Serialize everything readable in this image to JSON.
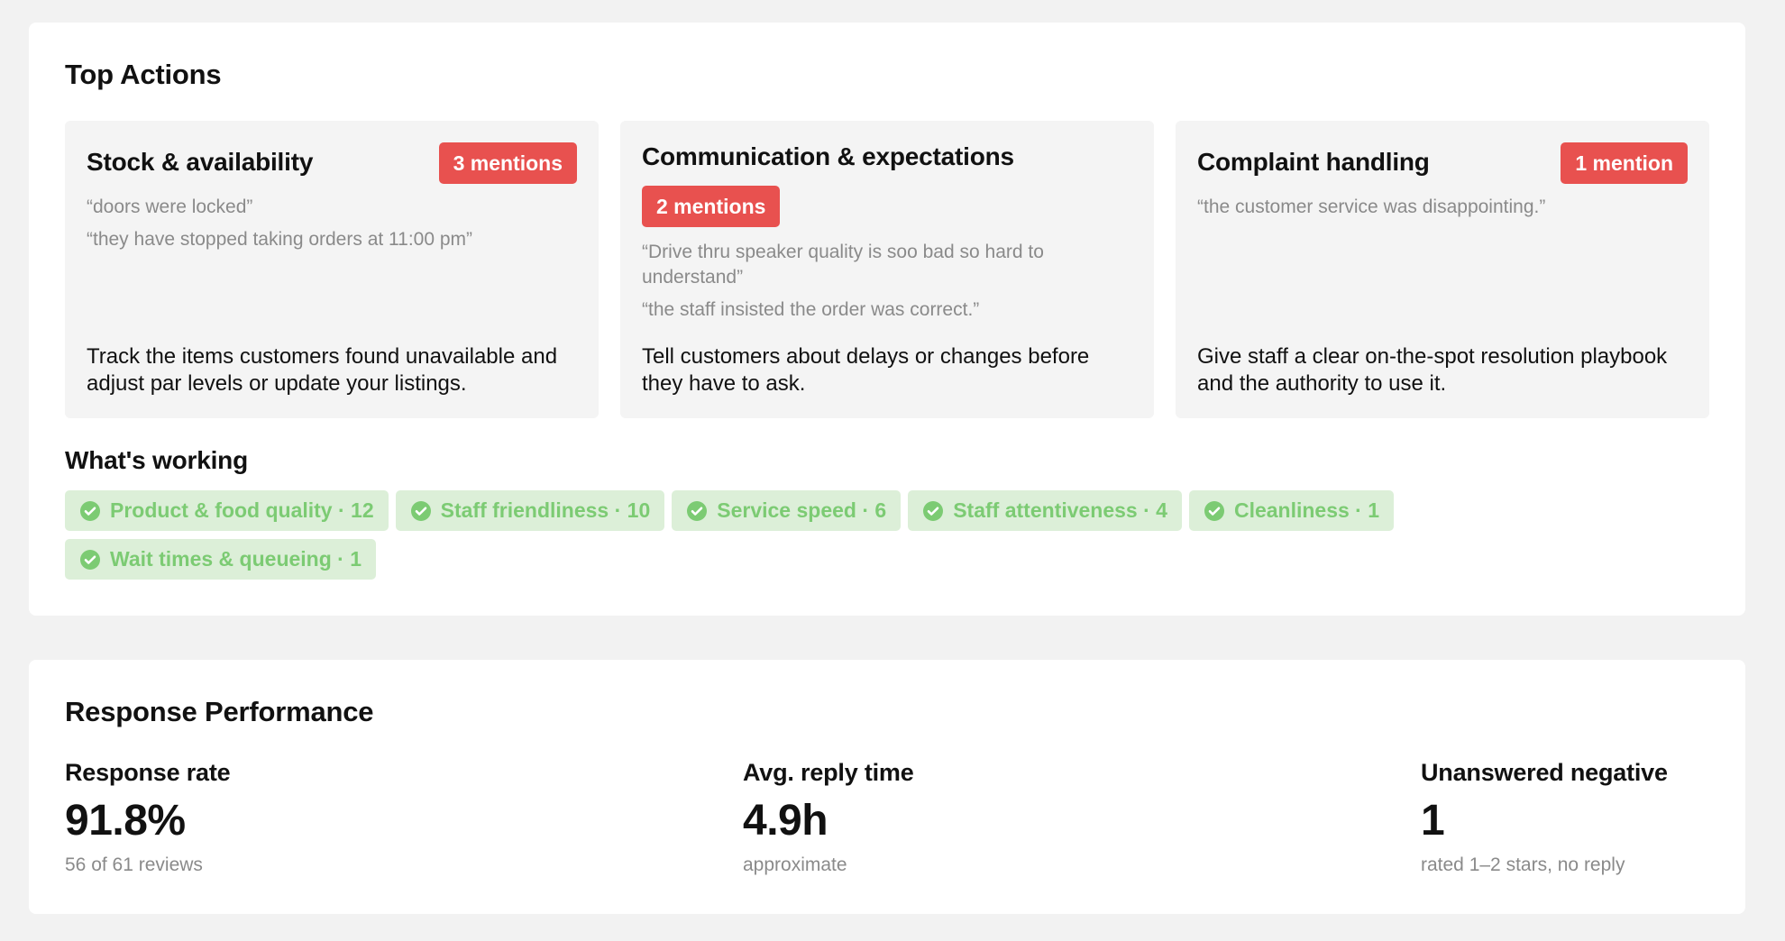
{
  "top_actions": {
    "title": "Top Actions",
    "cards": [
      {
        "title": "Stock & availability",
        "badge": "3 mentions",
        "quotes": [
          "“doors were locked”",
          "“they have stopped taking orders at 11:00 pm”"
        ],
        "action": "Track the items customers found unavailable and adjust par levels or update your listings."
      },
      {
        "title": "Communication & expectations",
        "badge": "2 mentions",
        "quotes": [
          "“Drive thru speaker quality is soo bad so hard to understand”",
          "“the staff insisted the order was correct.”"
        ],
        "action": "Tell customers about delays or changes before they have to ask."
      },
      {
        "title": "Complaint handling",
        "badge": "1 mention",
        "quotes": [
          "“the customer service was disappointing.”"
        ],
        "action": "Give staff a clear on-the-spot resolution playbook and the authority to use it."
      }
    ],
    "working": {
      "title": "What's working",
      "chips": [
        "Product & food quality · 12",
        "Staff friendliness · 10",
        "Service speed · 6",
        "Staff attentiveness · 4",
        "Cleanliness · 1",
        "Wait times & queueing · 1"
      ],
      "chip_icon": "check-circle-icon",
      "chip_color": "#7ccb73",
      "chip_bg": "#dcefd8"
    },
    "badge_color": "#e8514f"
  },
  "response_performance": {
    "title": "Response Performance",
    "metrics": [
      {
        "label": "Response rate",
        "value": "91.8%",
        "sub": "56 of 61 reviews"
      },
      {
        "label": "Avg. reply time",
        "value": "4.9h",
        "sub": "approximate"
      },
      {
        "label": "Unanswered negative",
        "value": "1",
        "sub": "rated 1–2 stars, no reply"
      }
    ]
  }
}
